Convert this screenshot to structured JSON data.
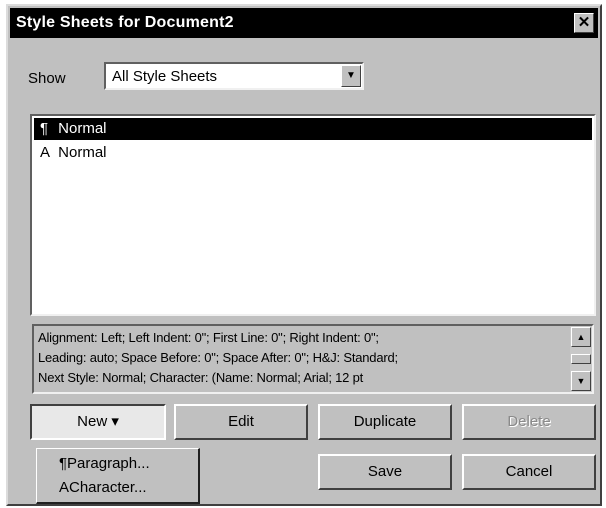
{
  "window": {
    "title": "Style Sheets for Document2",
    "close_glyph": "✕"
  },
  "show": {
    "label": "Show",
    "selected": "All Style Sheets",
    "arrow_glyph": "▼"
  },
  "style_list": [
    {
      "glyph": "¶",
      "name": "Normal",
      "kind": "paragraph",
      "selected": true
    },
    {
      "glyph": "A",
      "name": "Normal",
      "kind": "character",
      "selected": false
    }
  ],
  "description": {
    "lines": [
      "Alignment: Left;  Left Indent: 0\";  First Line: 0\";  Right Indent: 0\";",
      "Leading: auto;  Space Before: 0\";  Space After: 0\";  H&J: Standard;",
      " Next Style: Normal;  Character: (Name: Normal;  Arial;  12 pt"
    ],
    "scroll_up_glyph": "▲",
    "scroll_down_glyph": "▼"
  },
  "buttons": {
    "new": "New ▾",
    "edit": "Edit",
    "duplicate": "Duplicate",
    "delete": "Delete",
    "save": "Save",
    "cancel": "Cancel"
  },
  "new_menu": {
    "items": [
      "¶Paragraph...",
      "ACharacter..."
    ]
  },
  "icons": {
    "close": "close-icon",
    "dropdown": "chevron-down-icon",
    "paragraph": "pilcrow-icon",
    "character": "character-style-icon"
  },
  "colors": {
    "dialog_bg": "#c0c0c0",
    "titlebar_bg": "#000000",
    "selection_bg": "#000000"
  }
}
